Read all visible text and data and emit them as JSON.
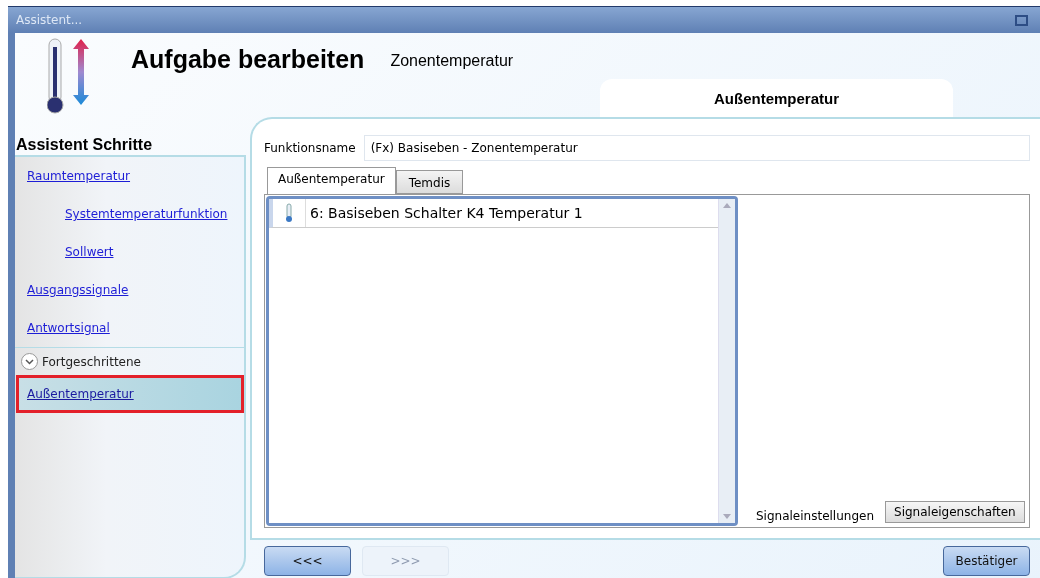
{
  "window": {
    "title": "Assistent..."
  },
  "header": {
    "title": "Aufgabe bearbeiten",
    "subtitle": "Zonentemperatur",
    "page_tab": "Außentemperatur"
  },
  "sidebar": {
    "title": "Assistent Schritte",
    "items": [
      {
        "label": "Raumtemperatur",
        "selected": false,
        "children": [
          {
            "label": "Systemtemperaturfunktion",
            "selected": false
          },
          {
            "label": "Sollwert",
            "selected": false
          }
        ]
      },
      {
        "label": "Ausgangssignale",
        "selected": false
      },
      {
        "label": "Antwortsignal",
        "selected": false
      }
    ],
    "advanced": {
      "label": "Fortgeschrittene",
      "expanded": true,
      "items": [
        {
          "label": "Außentemperatur",
          "selected": true
        }
      ]
    }
  },
  "form": {
    "function_label": "Funktionsname",
    "function_value": "(Fx) Basiseben - Zonentemperatur",
    "tabs": [
      {
        "label": "Außentemperatur",
        "selected": true
      },
      {
        "label": "Temdis",
        "selected": false
      }
    ],
    "signals": [
      {
        "label": "6: Basiseben Schalter K4 Temperatur 1"
      }
    ],
    "detail_tabs": [
      {
        "label": "Signaleinstellungen",
        "selected": true
      },
      {
        "label": "Signaleigenschaften",
        "selected": false
      }
    ]
  },
  "buttons": [
    {
      "label": "<<<",
      "disabled": false
    },
    {
      "label": ">>>",
      "disabled": true
    },
    {
      "label": "Bestätiger",
      "disabled": false
    }
  ]
}
